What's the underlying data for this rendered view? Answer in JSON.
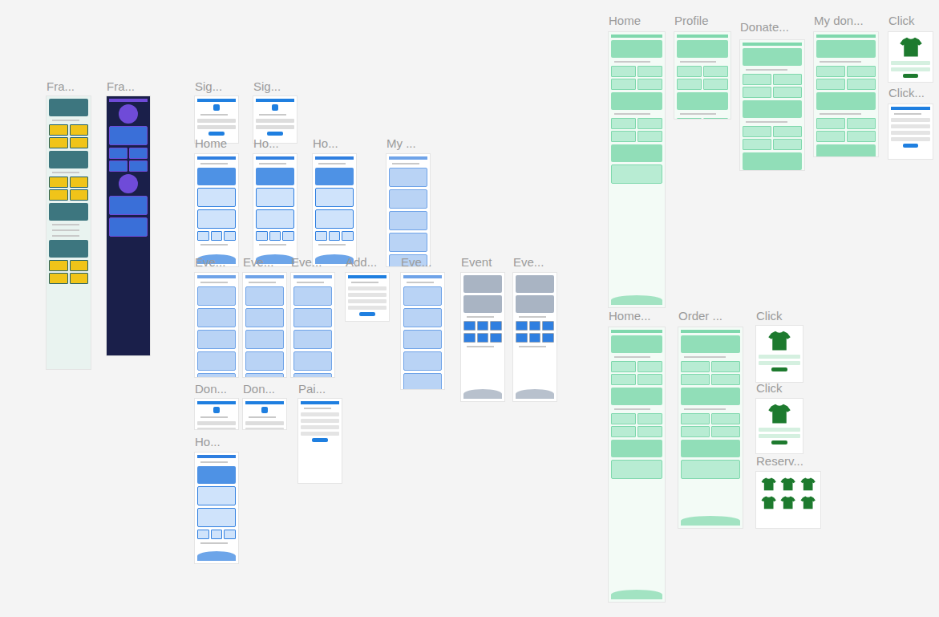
{
  "frames": [
    {
      "label": "Fra...",
      "kind": "car"
    },
    {
      "label": "Fra...",
      "kind": "dark"
    },
    {
      "label": "Sig...",
      "kind": "signin"
    },
    {
      "label": "Sig...",
      "kind": "signin"
    },
    {
      "label": "Home",
      "kind": "blue"
    },
    {
      "label": "Ho...",
      "kind": "blue"
    },
    {
      "label": "Ho...",
      "kind": "blue"
    },
    {
      "label": "My ...",
      "kind": "list"
    },
    {
      "label": "Eve...",
      "kind": "list"
    },
    {
      "label": "Eve...",
      "kind": "list"
    },
    {
      "label": "Eve...",
      "kind": "list"
    },
    {
      "label": "Add...",
      "kind": "form"
    },
    {
      "label": "Eve...",
      "kind": "list"
    },
    {
      "label": "Event",
      "kind": "photo"
    },
    {
      "label": "Eve...",
      "kind": "photo"
    },
    {
      "label": "Don...",
      "kind": "signin"
    },
    {
      "label": "Don...",
      "kind": "signin"
    },
    {
      "label": "Pai...",
      "kind": "form"
    },
    {
      "label": "Ho...",
      "kind": "blue"
    },
    {
      "label": "Home",
      "kind": "green"
    },
    {
      "label": "Profile",
      "kind": "green"
    },
    {
      "label": "Donate...",
      "kind": "green"
    },
    {
      "label": "My don...",
      "kind": "green"
    },
    {
      "label": "Click",
      "kind": "tshirt"
    },
    {
      "label": "Click...",
      "kind": "form"
    },
    {
      "label": "Home...",
      "kind": "green"
    },
    {
      "label": "Order ...",
      "kind": "green"
    },
    {
      "label": "Click",
      "kind": "tshirt"
    },
    {
      "label": "Click",
      "kind": "tshirt"
    },
    {
      "label": "Reserv...",
      "kind": "shirts"
    }
  ]
}
